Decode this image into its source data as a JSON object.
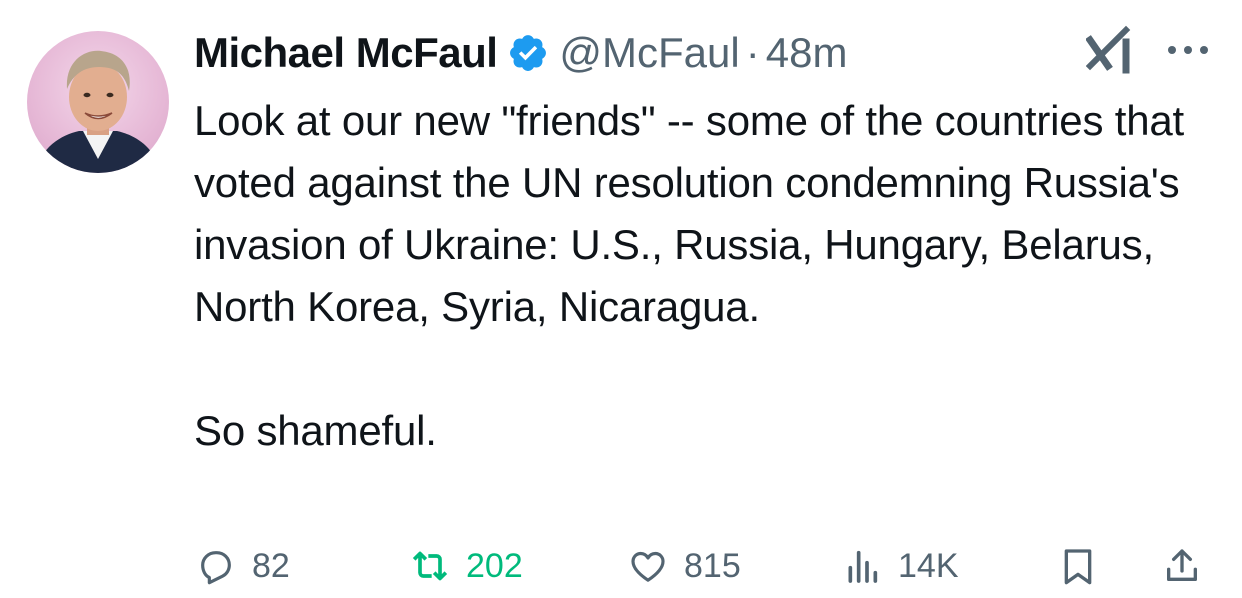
{
  "author": {
    "name": "Michael McFaul",
    "handle": "@McFaul",
    "separator": "·",
    "time": "48m"
  },
  "tweet": {
    "text_main": "Look at our new \"friends\" -- some of the countries that voted against the UN resolution condemning Russia's invasion of Ukraine:  U.S., Russia, Hungary, Belarus, North Korea, Syria, Nicaragua.",
    "text_end": "So shameful."
  },
  "metrics": {
    "replies": "82",
    "retweets": "202",
    "likes": "815",
    "views": "14K"
  },
  "colors": {
    "verified": "#1d9bf0",
    "retweet_active": "#00ba7c",
    "muted": "#536471"
  },
  "icons": [
    "verified-badge-icon",
    "grok-icon",
    "more-icon",
    "reply-icon",
    "retweet-icon",
    "like-icon",
    "views-icon",
    "bookmark-icon",
    "share-icon"
  ]
}
